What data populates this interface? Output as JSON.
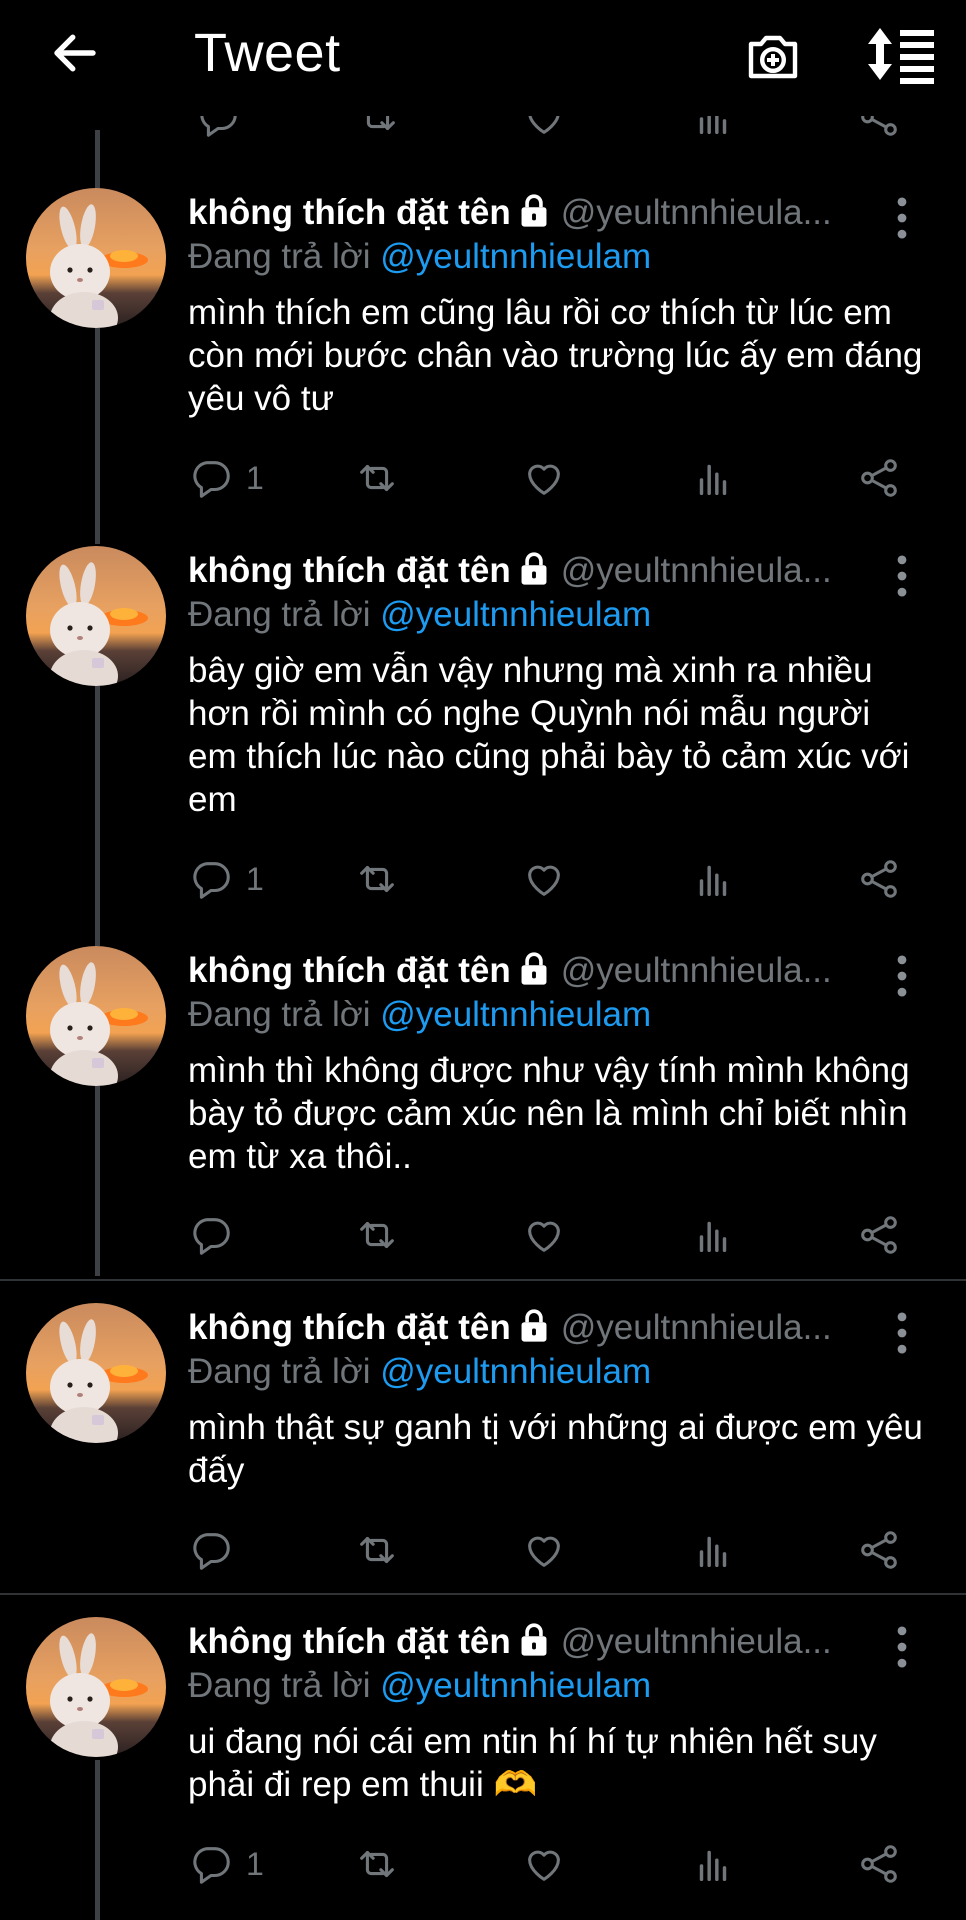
{
  "header": {
    "title": "Tweet",
    "back_icon": "arrow-left-icon",
    "camera_icon": "camera-plus-icon",
    "sort_icon": "sort-order-icon"
  },
  "colors": {
    "background": "#000000",
    "link": "#1d9bf0",
    "muted": "#71767b",
    "divider": "#2f3336"
  },
  "tweets": [
    {
      "name": "không thích đặt tên",
      "handle": "@yeultnnhieula...",
      "reply_prefix": "Đang trả lời",
      "reply_to": "@yeultnnhieulam",
      "text": "mình thích em cũng lâu rồi cơ thích từ lúc em còn mới bước chân vào trường lúc ấy em đáng yêu vô tư",
      "reply_count": "1"
    },
    {
      "name": "không thích đặt tên",
      "handle": "@yeultnnhieula...",
      "reply_prefix": "Đang trả lời",
      "reply_to": "@yeultnnhieulam",
      "text": "bây giờ em vẫn vậy nhưng mà xinh ra nhiều hơn rồi mình có nghe Quỳnh nói mẫu người em thích lúc nào cũng phải bày tỏ cảm xúc với em",
      "reply_count": "1"
    },
    {
      "name": "không thích đặt tên",
      "handle": "@yeultnnhieula...",
      "reply_prefix": "Đang trả lời",
      "reply_to": "@yeultnnhieulam",
      "text": "mình thì không được như vậy tính mình không bày tỏ được cảm xúc nên là mình chỉ biết nhìn em từ xa thôi..",
      "reply_count": ""
    },
    {
      "name": "không thích đặt tên",
      "handle": "@yeultnnhieula...",
      "reply_prefix": "Đang trả lời",
      "reply_to": "@yeultnnhieulam",
      "text": "mình thật sự ganh tị với những ai được em yêu đấy",
      "reply_count": ""
    },
    {
      "name": "không thích đặt tên",
      "handle": "@yeultnnhieula...",
      "reply_prefix": "Đang trả lời",
      "reply_to": "@yeultnnhieulam",
      "text": "ui đang nói cái em ntin hí hí tự nhiên hết suy phải đi rep em thuii 🫶",
      "reply_count": "1"
    }
  ]
}
